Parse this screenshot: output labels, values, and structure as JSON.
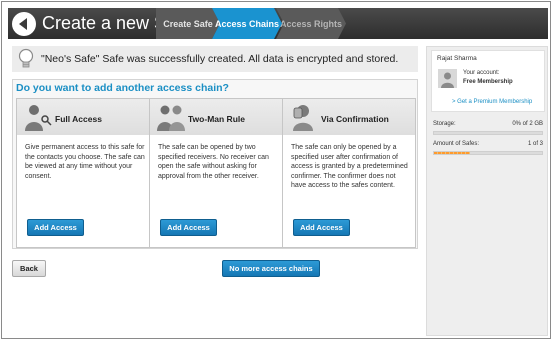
{
  "header": {
    "title": "Create a new Safe",
    "steps": [
      "Create Safe",
      "Access Chains",
      "Access Rights"
    ],
    "active_step": 1
  },
  "notice": {
    "text": "\"Neo's Safe\" Safe was successfully created. All data is encrypted and stored.",
    "icon": "lightbulb-icon"
  },
  "main": {
    "question": "Do you want to add another access chain?",
    "cards": [
      {
        "title": "Full Access",
        "icon": "person-key-icon",
        "description": "Give permanent access to this safe for the contacts you choose. The safe can be viewed at any time without your consent.",
        "button": "Add Access"
      },
      {
        "title": "Two-Man Rule",
        "icon": "two-persons-icon",
        "description": "The safe can be opened by two specified receivers. No receiver can open the safe without asking for approval from the other receiver.",
        "button": "Add Access"
      },
      {
        "title": "Via Confirmation",
        "icon": "person-hand-icon",
        "description": "The safe can only be opened by a specified user after confirmation of access is granted by a predetermined confirmer. The confirmer does not have access to the safes content.",
        "button": "Add Access"
      }
    ],
    "back_button": "Back",
    "no_more_button": "No more access chains"
  },
  "sidebar": {
    "user_name": "Rajat Sharma",
    "account_label": "Your account:",
    "account_type": "Free Membership",
    "premium_link": "> Get a Premium Membership",
    "storage_label": "Storage:",
    "storage_value": "0% of 2 GB",
    "storage_fraction": 0,
    "safes_label": "Amount of Safes:",
    "safes_value": "1 of 3",
    "safes_fraction": 0.333
  },
  "colors": {
    "accent": "#1b8fc4",
    "header_bg": "#3a3a3a",
    "progress": "#ff9a2e"
  }
}
